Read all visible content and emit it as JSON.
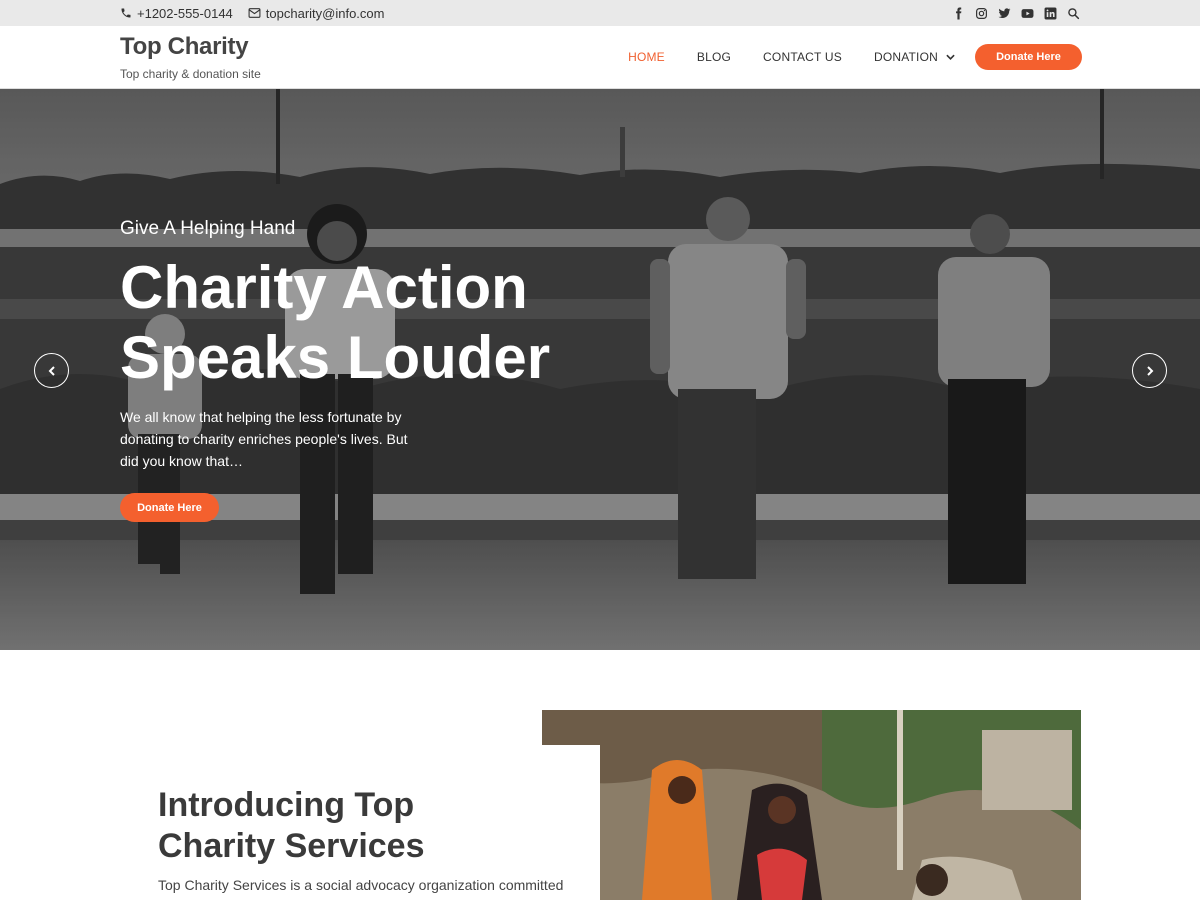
{
  "topbar": {
    "phone": "+1202-555-0144",
    "email": "topcharity@info.com",
    "social_icons": [
      "facebook-icon",
      "instagram-icon",
      "twitter-icon",
      "youtube-icon",
      "linkedin-icon",
      "search-icon"
    ]
  },
  "site": {
    "title": "Top Charity",
    "tagline": "Top charity & donation site"
  },
  "nav": {
    "items": [
      {
        "label": "HOME",
        "active": true
      },
      {
        "label": "BLOG"
      },
      {
        "label": "CONTACT US"
      },
      {
        "label": "DONATION",
        "has_dropdown": true
      }
    ],
    "cta": "Donate Here"
  },
  "hero": {
    "subtitle": "Give A Helping Hand",
    "headline": "Charity Action Speaks Louder",
    "description": "We all know that helping the less fortunate by donating to charity enriches people's lives. But did you know that…",
    "cta": "Donate Here"
  },
  "intro": {
    "title": "Introducing Top Charity Services",
    "text": "Top Charity Services is a social advocacy organization committed"
  },
  "colors": {
    "accent": "#f4602e",
    "nav_active": "#f06030",
    "topbar_bg": "#e9e9e9"
  }
}
